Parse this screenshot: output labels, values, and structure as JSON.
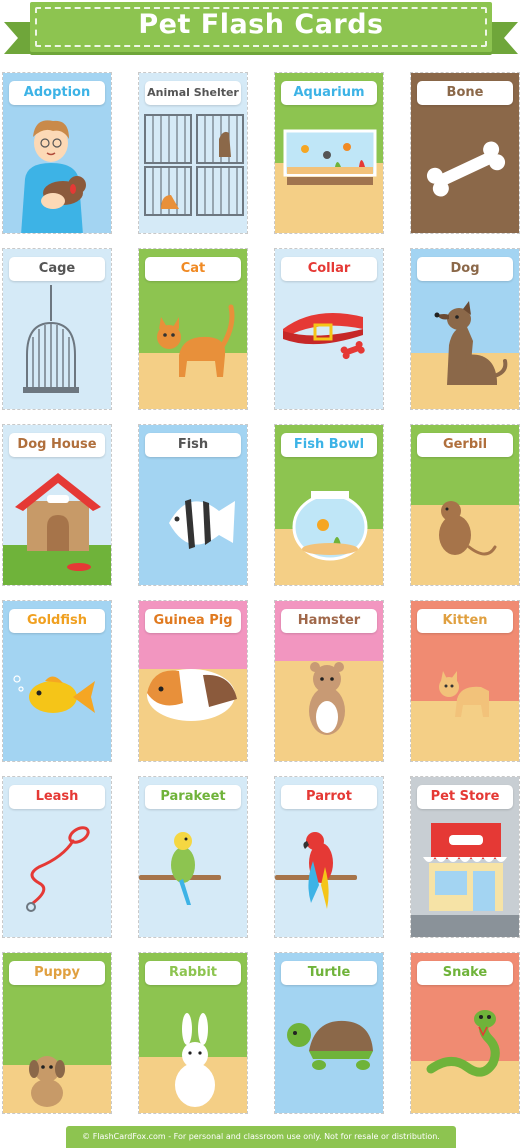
{
  "title": "Pet Flash Cards",
  "footer": "© FlashCardFox.com - For personal and classroom use only. Not for resale or distribution.",
  "colors": {
    "banner": "#8dc450",
    "light_blue": "#d5eaf7",
    "blue": "#a3d4f2",
    "green": "#8dc450",
    "sand": "#f4cf86",
    "brown": "#8b6849",
    "pink": "#f296c0",
    "salmon": "#f08b72",
    "grey": "#c8ced3"
  },
  "cards": [
    {
      "label": "Adoption",
      "label_color": "#3db3e6"
    },
    {
      "label": "Animal Shelter",
      "label_color": "#555555"
    },
    {
      "label": "Aquarium",
      "label_color": "#3db3e6"
    },
    {
      "label": "Bone",
      "label_color": "#8b6849"
    },
    {
      "label": "Cage",
      "label_color": "#555555"
    },
    {
      "label": "Cat",
      "label_color": "#f08a24"
    },
    {
      "label": "Collar",
      "label_color": "#e53935"
    },
    {
      "label": "Dog",
      "label_color": "#8b6849"
    },
    {
      "label": "Dog House",
      "label_color": "#b06f3c"
    },
    {
      "label": "Fish",
      "label_color": "#555555"
    },
    {
      "label": "Fish Bowl",
      "label_color": "#3db3e6"
    },
    {
      "label": "Gerbil",
      "label_color": "#b06f3c"
    },
    {
      "label": "Goldfish",
      "label_color": "#f0a020"
    },
    {
      "label": "Guinea Pig",
      "label_color": "#e07a20"
    },
    {
      "label": "Hamster",
      "label_color": "#a0684a"
    },
    {
      "label": "Kitten",
      "label_color": "#e0a040"
    },
    {
      "label": "Leash",
      "label_color": "#e53935"
    },
    {
      "label": "Parakeet",
      "label_color": "#6fb33a"
    },
    {
      "label": "Parrot",
      "label_color": "#e53935"
    },
    {
      "label": "Pet Store",
      "label_color": "#e53935"
    },
    {
      "label": "Puppy",
      "label_color": "#e0a040"
    },
    {
      "label": "Rabbit",
      "label_color": "#8dc450"
    },
    {
      "label": "Turtle",
      "label_color": "#6fb33a"
    },
    {
      "label": "Snake",
      "label_color": "#6fb33a"
    }
  ]
}
